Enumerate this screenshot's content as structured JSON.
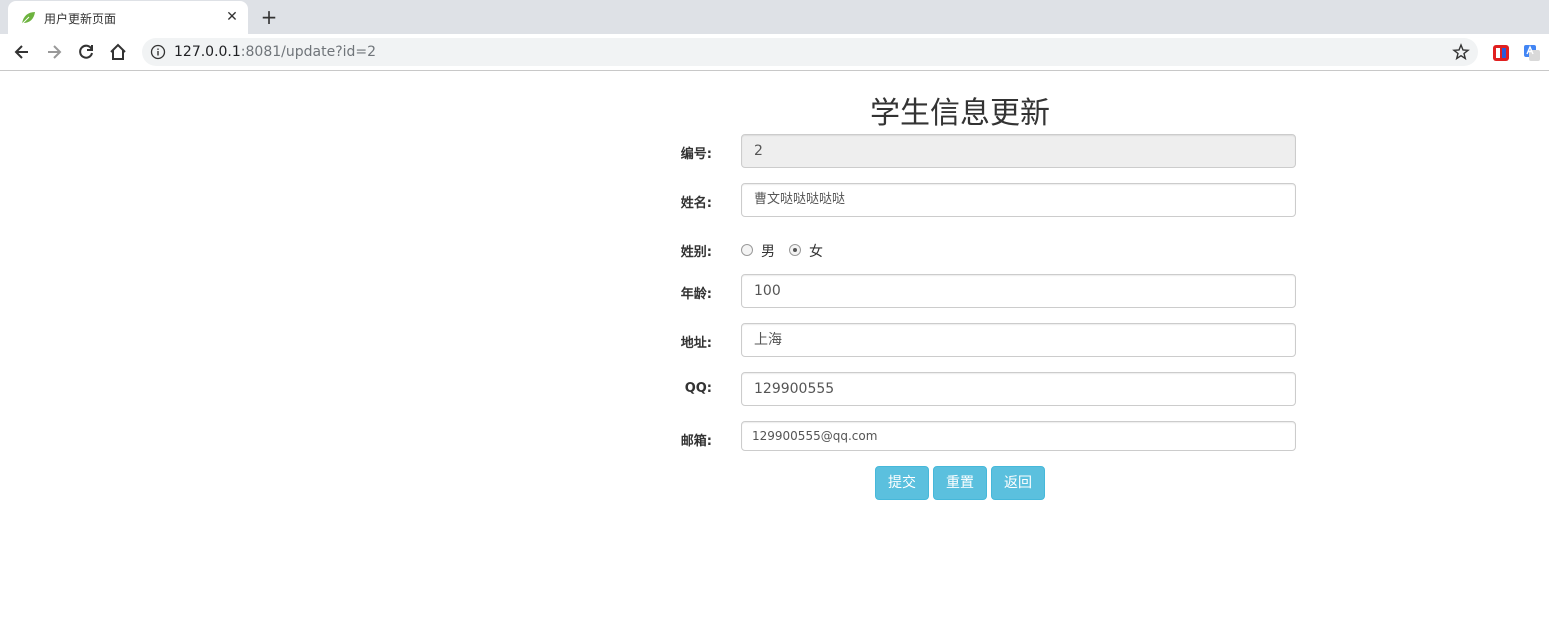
{
  "browser": {
    "tab_title": "用户更新页面",
    "url_host": "127.0.0.1",
    "url_rest": ":8081/update?id=2"
  },
  "form": {
    "title": "学生信息更新",
    "id": {
      "label": "编号:",
      "value": "2"
    },
    "name": {
      "label": "姓名:",
      "value": "曹文哒哒哒哒哒"
    },
    "gender": {
      "label": "姓别:",
      "options": [
        "男",
        "女"
      ],
      "selected": "女"
    },
    "age": {
      "label": "年龄:",
      "value": "100"
    },
    "address": {
      "label": "地址:",
      "value": "上海"
    },
    "qq": {
      "label": "QQ:",
      "value": "129900555"
    },
    "email": {
      "label": "邮箱:",
      "value": "129900555@qq.com"
    },
    "buttons": {
      "submit": "提交",
      "reset": "重置",
      "back": "返回"
    }
  },
  "colors": {
    "button": "#5bc0de",
    "button_border": "#46b8da",
    "readonly_bg": "#eeeeee"
  }
}
